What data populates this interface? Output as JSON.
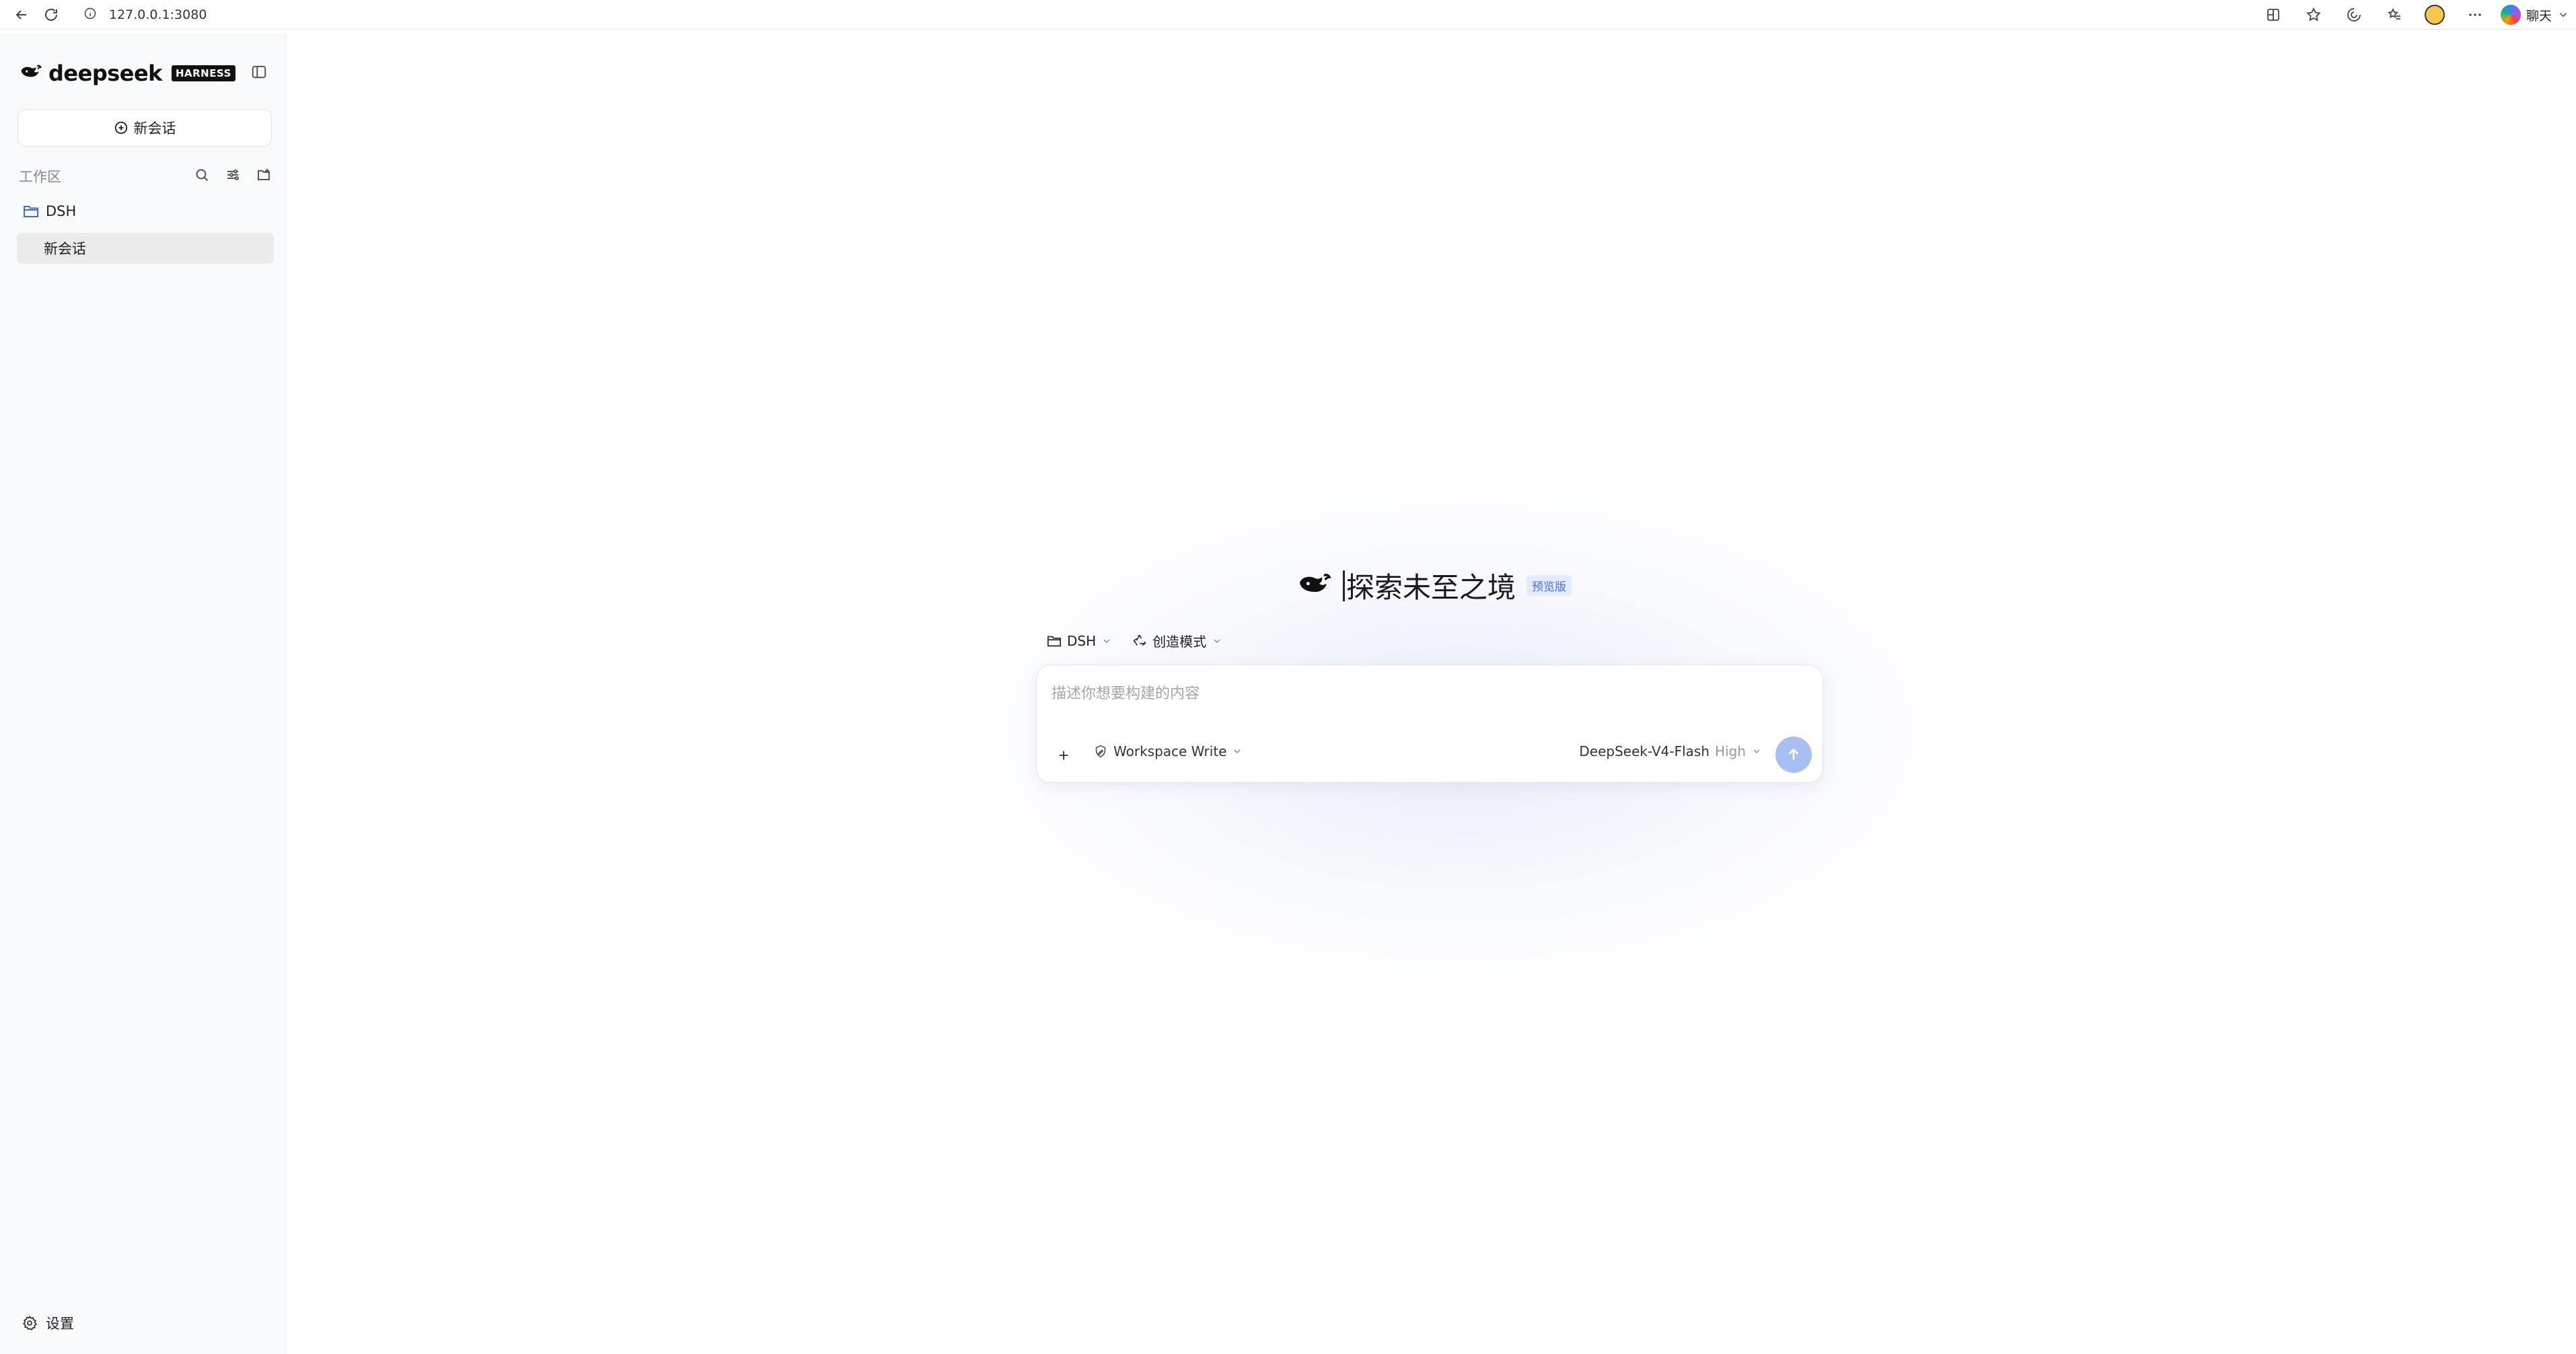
{
  "browser": {
    "url": "127.0.0.1:3080",
    "chat_label": "聊天"
  },
  "sidebar": {
    "brand_name": "deepseek",
    "brand_badge": "HARNESS",
    "new_chat_label": "新会话",
    "workspace_label": "工作区",
    "folder_name": "DSH",
    "sessions": [
      {
        "label": "新会话",
        "active": true
      }
    ],
    "settings_label": "设置"
  },
  "main": {
    "hero_title": "探索未至之境",
    "hero_badge": "预览版",
    "folder_chip": "DSH",
    "mode_chip": "创造模式",
    "composer": {
      "placeholder": "描述你想要构建的内容",
      "value": "",
      "permission_mode": "Workspace Write",
      "model_name": "DeepSeek-V4-Flash",
      "model_level": "High"
    }
  },
  "colors": {
    "accent_send": "#a9bff2",
    "badge_bg": "#e3ebff",
    "badge_text": "#4a6fd1",
    "sidebar_bg": "#f9fafb",
    "active_item_bg": "#ebebec"
  },
  "icons": [
    "back-arrow-icon",
    "reload-icon",
    "info-icon",
    "split-screen-icon",
    "star-icon",
    "extensions-icon",
    "favorites-icon",
    "more-icon",
    "whale-logo-icon",
    "sidebar-toggle-icon",
    "plus-circle-icon",
    "search-icon",
    "sliders-icon",
    "new-folder-icon",
    "folder-icon",
    "gear-icon",
    "recycle-icon",
    "chevron-down-icon",
    "plus-icon",
    "pen-shield-icon",
    "arrow-up-icon"
  ]
}
